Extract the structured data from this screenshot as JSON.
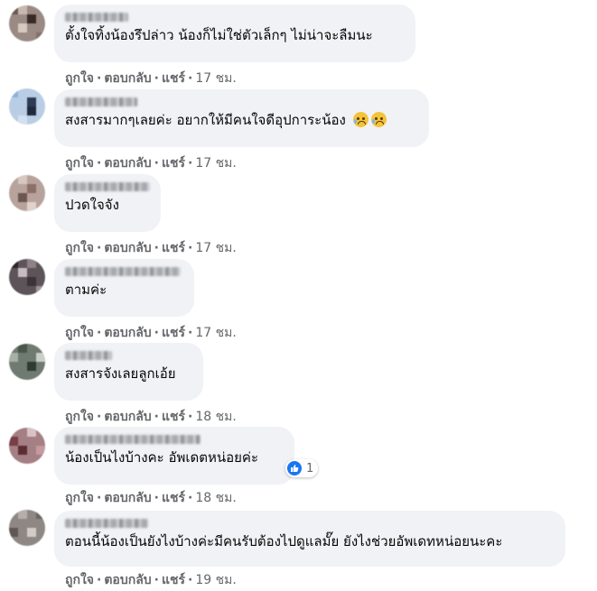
{
  "actions": {
    "like": "ถูกใจ",
    "reply": "ตอบกลับ",
    "share": "แชร์",
    "sep": "·"
  },
  "comments": [
    {
      "text": "ตั้งใจทิ้งน้องรึปล่าว น้องก็ไม่ใช่ตัวเล็กๆ ไม่น่าจะลืมนะ",
      "time": "17 ชม."
    },
    {
      "text": "สงสารมากๆเลยค่ะ อยากให้มีคนใจดีอุปการะน้อง",
      "emoji": "crying-face",
      "time": "17 ชม."
    },
    {
      "text": "ปวดใจจัง",
      "time": "17 ชม."
    },
    {
      "text": "ตามค่ะ",
      "time": "17 ชม."
    },
    {
      "text": "สงสารจังเลยลูกเอ้ย",
      "time": "18 ชม."
    },
    {
      "text": "น้องเป็นไงบ้างคะ อัพเดตหน่อยค่ะ",
      "time": "18 ชม.",
      "reaction": {
        "icon": "like-icon",
        "count": "1"
      }
    },
    {
      "text": "ตอนนี้น้องเป็นยังไงบ้างค่ะมีคนรับต้องไปดูแลมั๊ย ยังไงช่วยอัพเดทหน่อยนะคะ",
      "time": "19 ชม."
    }
  ],
  "colors": {
    "bubble": "#f0f2f5",
    "meta": "#65676b",
    "like": "#1877f2"
  }
}
